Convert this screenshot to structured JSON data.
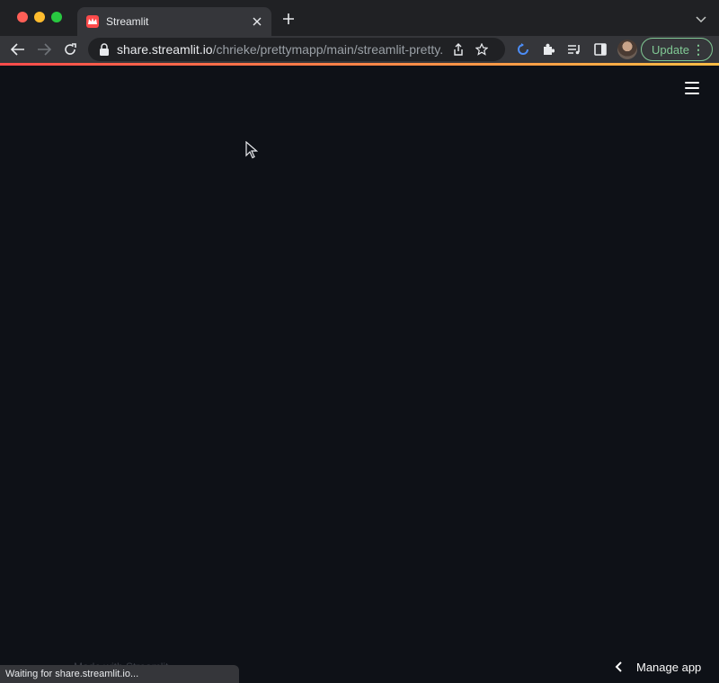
{
  "browser": {
    "tab": {
      "title": "Streamlit",
      "favicon": "streamlit-crown-icon"
    },
    "address": {
      "domain": "share.streamlit.io",
      "path": "/chrieke/prettymapp/main/streamlit-pretty..."
    },
    "update_label": "Update",
    "status_text": "Waiting for share.streamlit.io..."
  },
  "app": {
    "footer_text": "Made with Streamlit",
    "manage_app_label": "Manage app",
    "background": "#0e1117",
    "accent_gradient": [
      "#ff4b4b",
      "#ffbd45"
    ]
  }
}
